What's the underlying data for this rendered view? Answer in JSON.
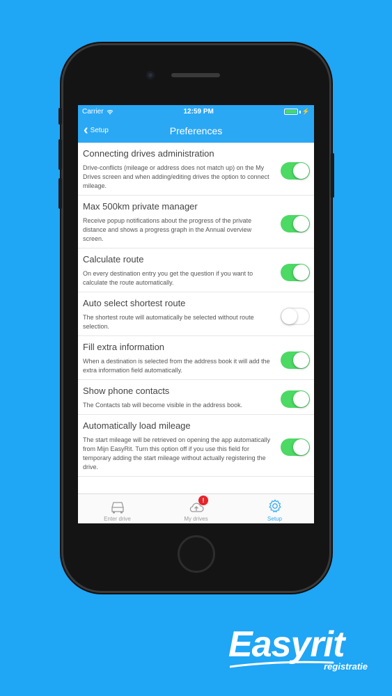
{
  "statusbar": {
    "carrier": "Carrier",
    "time": "12:59 PM"
  },
  "navbar": {
    "back_label": "Setup",
    "title": "Preferences"
  },
  "preferences": [
    {
      "title": "Connecting drives administration",
      "description": "Drive-conflicts (mileage or address does not match up) on the My Drives screen and when adding/editing drives the option to connect mileage.",
      "enabled": true
    },
    {
      "title": "Max 500km private manager",
      "description": "Receive popup notifications about the progress of the private distance and shows a progress graph in the Annual overview screen.",
      "enabled": true
    },
    {
      "title": "Calculate route",
      "description": "On every destination entry you get the question if you want to calculate the route automatically.",
      "enabled": true
    },
    {
      "title": "Auto select shortest route",
      "description": "The shortest route will automatically be selected without route selection.",
      "enabled": false
    },
    {
      "title": "Fill extra information",
      "description": "When a destination is selected from the address book it will add the extra information field automatically.",
      "enabled": true
    },
    {
      "title": "Show phone contacts",
      "description": "The Contacts tab will become visible in the address book.",
      "enabled": true
    },
    {
      "title": "Automatically load mileage",
      "description": "The start mileage will be retrieved on opening the app automatically from Mijn EasyRit. Turn this option off if you use this field for temporary adding the start mileage without actually registering the drive.",
      "enabled": true
    }
  ],
  "tabbar": {
    "tabs": [
      {
        "label": "Enter drive",
        "icon": "car-icon"
      },
      {
        "label": "My drives",
        "icon": "cloud-upload-icon",
        "badge": "!"
      },
      {
        "label": "Setup",
        "icon": "gear-icon"
      }
    ],
    "active": "Setup"
  },
  "logo": {
    "main": "Easyrit",
    "sub": "registratie"
  },
  "colors": {
    "accent": "#2aa8f4",
    "background": "#1fa6f5",
    "toggle_on": "#4cd964",
    "badge": "#e8242a"
  }
}
